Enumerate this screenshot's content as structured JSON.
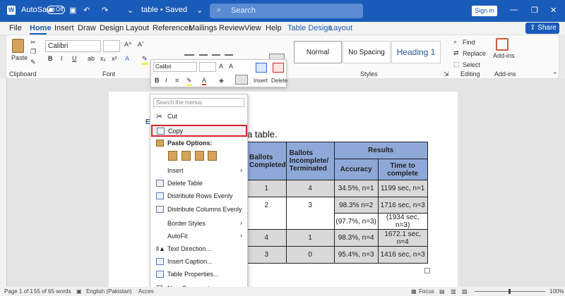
{
  "titlebar": {
    "autosave": "AutoSave",
    "toggle": "Off",
    "doc_title": "table • Saved",
    "search": "Search",
    "signin": "Sign in"
  },
  "menubar": {
    "items": [
      "File",
      "Home",
      "Insert",
      "Draw",
      "Design",
      "Layout",
      "References",
      "Mailings",
      "Review",
      "View",
      "Help",
      "Table Design",
      "Layout"
    ],
    "share": "Share"
  },
  "ribbon": {
    "paste": "Paste",
    "clipboard": "Clipboard",
    "font_name": "Calibri",
    "font": "Font",
    "style1": "Normal",
    "style2": "No Spacing",
    "style3": "Heading 1",
    "styles": "Styles",
    "find": "Find",
    "replace": "Replace",
    "select": "Select",
    "editing": "Editing",
    "addins": "Add-ins",
    "addins_group": "Add-ins"
  },
  "minibar": {
    "font": "Calibri",
    "insert": "Insert",
    "delete": "Delete"
  },
  "doc": {
    "text_frag": "a table."
  },
  "table": {
    "h1": "Ballots Completed",
    "h2": "Ballots Incomplete/ Terminated",
    "h3": "Results",
    "h3a": "Accuracy",
    "h3b": "Time to complete",
    "rows": [
      {
        "c": "1",
        "i": "4",
        "a": "34.5%, n=1",
        "t": "1199 sec, n=1"
      },
      {
        "c": "2",
        "i": "3",
        "a": "98.3% n=2",
        "a2": "(97.7%, n=3)",
        "t": "1716 sec, n=3",
        "t2": "(1934 sec, n=3)"
      },
      {
        "c": "4",
        "i": "1",
        "a": "98.3%, n=4",
        "t": "1672.1 sec, n=4"
      },
      {
        "c": "3",
        "i": "0",
        "a": "95.4%, n=3",
        "t": "1416 sec, n=3"
      }
    ]
  },
  "context_menu": {
    "search_placeholder": "Search the menus",
    "items": [
      "Cut",
      "Copy",
      "Paste Options:",
      "Insert",
      "Delete Table",
      "Distribute Rows Evenly",
      "Distribute Columns Evenly",
      "Border Styles",
      "AutoFit",
      "Text Direction...",
      "Insert Caption...",
      "Table Properties...",
      "New Comment"
    ]
  },
  "statusbar": {
    "page": "Page 1 of 1",
    "words": "55 of 65 words",
    "lang": "English (Pakistan)",
    "access": "Acces",
    "focus": "Focus",
    "zoom": "100%"
  }
}
